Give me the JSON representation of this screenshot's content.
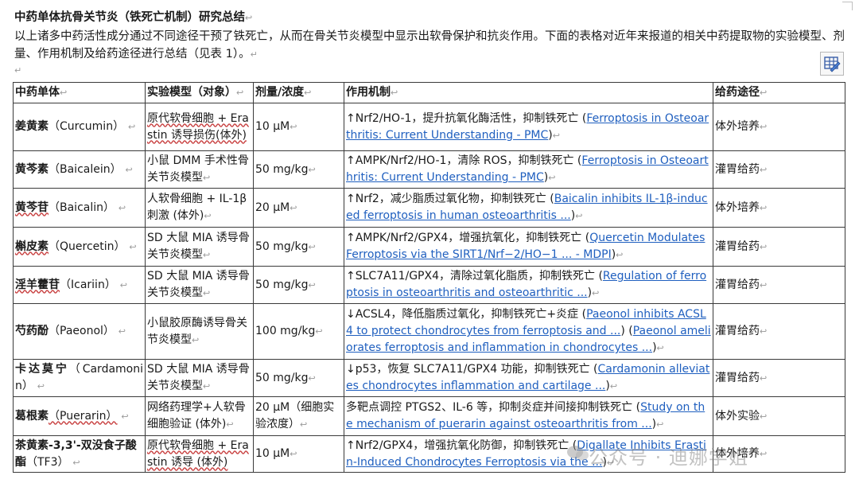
{
  "doc": {
    "title": "中药单体抗骨关节炎（铁死亡机制）研究总结",
    "intro": "以上诸多中药活性成分通过不同途径干预了铁死亡，从而在骨关节炎模型中显示出软骨保护和抗炎作用。下面的表格对近年来报道的相关中药提取物的实验模型、剂量、作用机制及给药途径进行总结（见表 1）。",
    "para_mark": "↵",
    "cell_mark": "↩"
  },
  "table": {
    "headers": [
      "中药单体",
      "实验模型（对象）",
      "剂量/浓度",
      "作用机制",
      "给药途径"
    ],
    "rows": [
      {
        "herb_cn": "姜黄素",
        "herb_en": "（Curcumin）",
        "model": "原代软骨细胞 + Erastin 诱导损伤(体外)",
        "dose": "10 μM",
        "mech": "↑Nrf2/HO-1，提升抗氧化酶活性，抑制铁死亡 (",
        "link": "Ferroptosis in Osteoarthritis: Current Understanding - PMC",
        "tail": ")",
        "route": "体外培养"
      },
      {
        "herb_cn": "黄芩素",
        "herb_en": "（Baicalein）",
        "model": "小鼠 DMM 手术性骨关节炎模型",
        "dose": "50 mg/kg",
        "mech": "↑AMPK/Nrf2/HO-1，清除 ROS，抑制铁死亡 (",
        "link": "Ferroptosis in Osteoarthritis: Current Understanding - PMC",
        "tail": ")",
        "route": "灌胃给药"
      },
      {
        "herb_cn": "黄芩苷",
        "herb_en": "（Baicalin）",
        "model": "人软骨细胞 + IL-1β 刺激 (体外)",
        "dose": "20 μM",
        "mech": "↑Nrf2，减少脂质过氧化物，抑制铁死亡 (",
        "link": "Baicalin inhibits IL-1β-induced ferroptosis in human osteoarthritis ...",
        "tail": ")",
        "route": "体外培养"
      },
      {
        "herb_cn": "槲皮素",
        "herb_en": "（Quercetin）",
        "model": "SD 大鼠 MIA 诱导骨关节炎模型",
        "dose": "50 mg/kg",
        "mech": "↑AMPK/Nrf2/GPX4，增强抗氧化，抑制铁死亡 (",
        "link": "Quercetin Modulates Ferroptosis via the SIRT1/Nrf−2/HO−1 ... - MDPI",
        "tail": ")",
        "route": "灌胃给药"
      },
      {
        "herb_cn": "淫羊藿苷",
        "herb_en": "（Icariin）",
        "model": "SD 大鼠 MIA 诱导骨关节炎模型",
        "dose": "50 mg/kg",
        "mech": "↑SLC7A11/GPX4，清除过氧化脂质，抑制铁死亡 (",
        "link": "Regulation of ferroptosis in osteoarthritis and osteoarthritic ...",
        "tail": ")",
        "route": "灌胃给药"
      },
      {
        "herb_cn": "芍药酚",
        "herb_en": "（Paeonol）",
        "model": "小鼠胶原酶诱导骨关节炎模型",
        "dose": "100 mg/kg",
        "mech": "↓ACSL4，降低脂质过氧化，抑制铁死亡+炎症 (",
        "link": "Paeonol inhibits ACSL4 to protect chondrocytes from ferroptosis and ...",
        "mid": ") (",
        "link2": "Paeonol ameliorates ferroptosis and inflammation in chondrocytes ...",
        "tail": ")",
        "route": "灌胃给药"
      },
      {
        "herb_cn": "卡达莫宁",
        "herb_en": "（Cardamonin）",
        "model": "SD 大鼠 MIA 诱导骨关节炎模型",
        "dose": "50 mg/kg",
        "mech": "↓p53，恢复 SLC7A11/GPX4 功能，抑制铁死亡 (",
        "link": "Cardamonin alleviates chondrocytes inflammation and cartilage ...",
        "tail": ")",
        "route": "灌胃给药"
      },
      {
        "herb_cn": "葛根素",
        "herb_en": "（Puerarin）",
        "model": "网络药理学+人软骨细胞验证 (体外)",
        "dose": "20 μM（细胞实验浓度）",
        "mech": "多靶点调控 PTGS2、IL-6 等，抑制炎症并间接抑制铁死亡 (",
        "link": "Study on the mechanism of puerarin against osteoarthritis from ...",
        "tail": ")",
        "route": "体外实验"
      },
      {
        "herb_cn": "茶黄素-3,3'-双没食子酸酯",
        "herb_en": "（TF3）",
        "model": "原代软骨细胞 + Erastin 诱导 (体外)",
        "dose": "10 μM",
        "mech": "↑Nrf2/GPX4，增强抗氧化防御，抑制铁死亡 (",
        "link": "Digallate Inhibits Erastin-Induced Chondrocytes Ferroptosis via the ...",
        "tail": ")",
        "route": "体外培养"
      }
    ]
  },
  "watermark": "公众号 · 迪娜学姐"
}
